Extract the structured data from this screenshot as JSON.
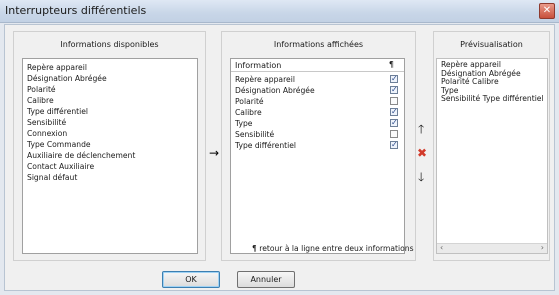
{
  "window": {
    "title": "Interrupteurs différentiels",
    "close_icon": "close-icon"
  },
  "available": {
    "title": "Informations disponibles",
    "items": [
      "Repère appareil",
      "Désignation Abrégée",
      "Polarité",
      "Calibre",
      "Type différentiel",
      "Sensibilité",
      "Connexion",
      "Type Commande",
      "Auxiliaire de déclenchement",
      "Contact Auxiliaire",
      "Signal défaut"
    ]
  },
  "displayed": {
    "title": "Informations affichées",
    "header_label": "Information",
    "header_pilcrow": "¶",
    "rows": [
      {
        "label": "Repère appareil",
        "checked": true
      },
      {
        "label": "Désignation Abrégée",
        "checked": true
      },
      {
        "label": "Polarité",
        "checked": false
      },
      {
        "label": "Calibre",
        "checked": true
      },
      {
        "label": "Type",
        "checked": true
      },
      {
        "label": "Sensibilité",
        "checked": false
      },
      {
        "label": "Type différentiel",
        "checked": true
      }
    ],
    "note": "¶ retour à la ligne entre deux informations"
  },
  "preview": {
    "title": "Prévisualisation",
    "lines": [
      "Repère appareil",
      "Désignation Abrégée",
      "Polarité Calibre",
      "Type",
      "Sensibilité Type différentiel"
    ]
  },
  "buttons": {
    "ok": "OK",
    "cancel": "Annuler"
  },
  "icons": {
    "add": "→",
    "up": "🡑",
    "remove": "✖",
    "down": "🡓",
    "scroll_left": "‹",
    "scroll_right": "›",
    "check": "✓"
  },
  "colors": {
    "remove": "#d23a2a",
    "arrows": "#1a1a1a"
  }
}
